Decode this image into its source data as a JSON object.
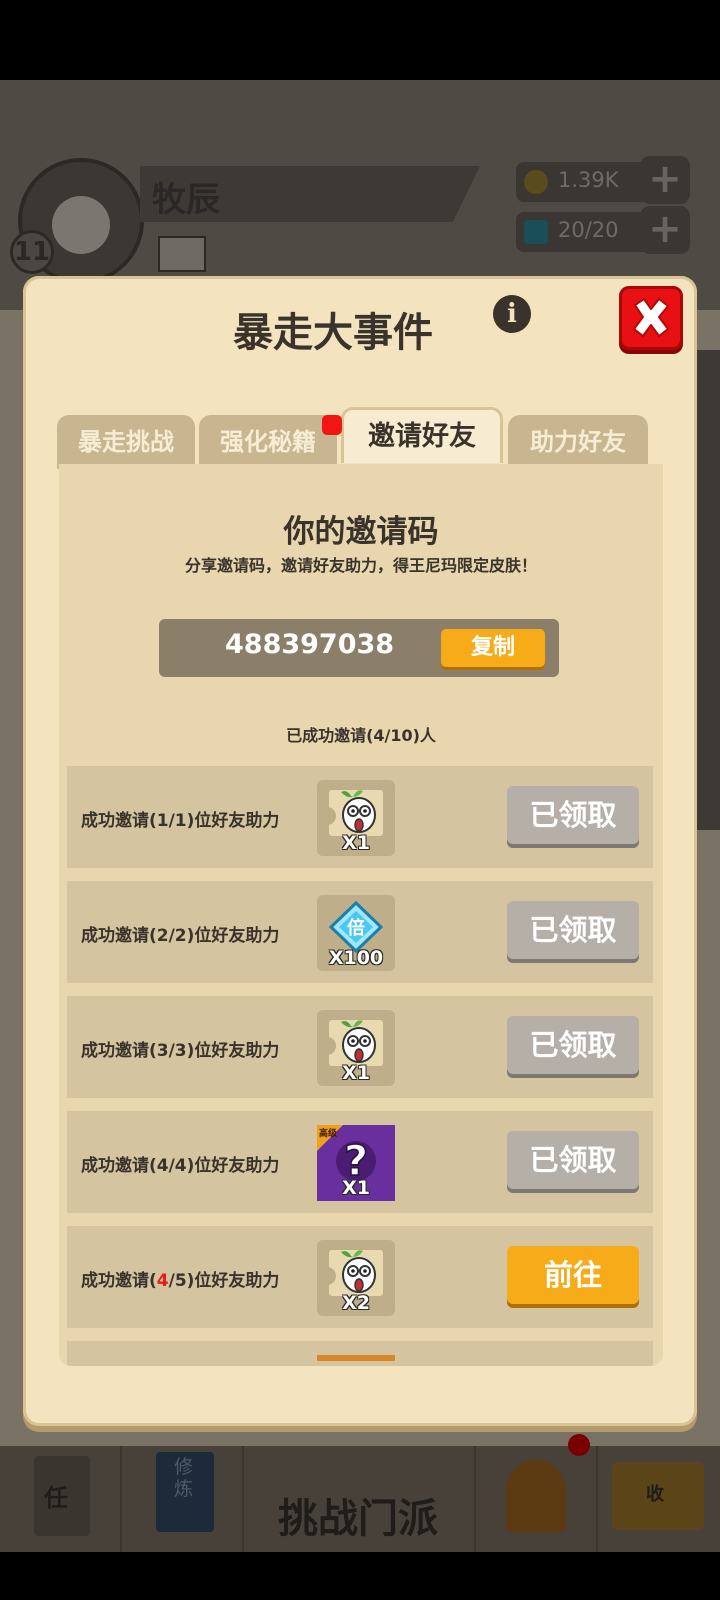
{
  "hud": {
    "level": "11",
    "player_name": "牧辰",
    "gold": "1.39K",
    "energy": "20/20",
    "gold_color": "#5a4c1a",
    "energy_color": "#1a4f5a"
  },
  "bottom_nav": {
    "title": "挑战门派",
    "icons": [
      "scroll-icon",
      "book-icon",
      "sword-icon",
      "helmet-icon",
      "shop-icon"
    ],
    "labels": {
      "task": "任",
      "cultivate": "修炼",
      "shop": "收"
    }
  },
  "modal": {
    "title": "暴走大事件",
    "tabs": [
      {
        "label": "暴走挑战",
        "active": false
      },
      {
        "label": "强化秘籍",
        "active": false,
        "badge": true
      },
      {
        "label": "邀请好友",
        "active": true
      },
      {
        "label": "助力好友",
        "active": false
      }
    ],
    "invite": {
      "heading": "你的邀请码",
      "subtitle": "分享邀请码，邀请好友助力，得王尼玛限定皮肤！",
      "code": "488397038",
      "copy_label": "复制",
      "progress_text": "已成功邀请(4/10)人"
    },
    "rewards": [
      {
        "label_pre": "成功邀请(1/1)位好友助力",
        "label_hl": "",
        "label_post": "",
        "item": "sprout-head-icon",
        "count": "X1",
        "button": "已领取",
        "state": "claimed"
      },
      {
        "label_pre": "成功邀请(2/2)位好友助力",
        "label_hl": "",
        "label_post": "",
        "item": "multiplier-gem-icon",
        "count": "X100",
        "button": "已领取",
        "state": "claimed"
      },
      {
        "label_pre": "成功邀请(3/3)位好友助力",
        "label_hl": "",
        "label_post": "",
        "item": "sprout-head-icon",
        "count": "X1",
        "button": "已领取",
        "state": "claimed"
      },
      {
        "label_pre": "成功邀请(4/4)位好友助力",
        "label_hl": "",
        "label_post": "",
        "item": "mystery-box-icon",
        "count": "X1",
        "button": "已领取",
        "state": "claimed",
        "corner_tag": "高级"
      },
      {
        "label_pre": "成功邀请(",
        "label_hl": "4",
        "label_post": "/5)位好友助力",
        "item": "sprout-head-icon",
        "count": "X2",
        "button": "前往",
        "state": "go"
      }
    ],
    "colors": {
      "panel": "#f3e3be",
      "accent_orange": "#f8ab18",
      "close_red": "#e81012",
      "claimed_gray": "#b5afa7",
      "highlight_red": "#e21d1d"
    }
  }
}
